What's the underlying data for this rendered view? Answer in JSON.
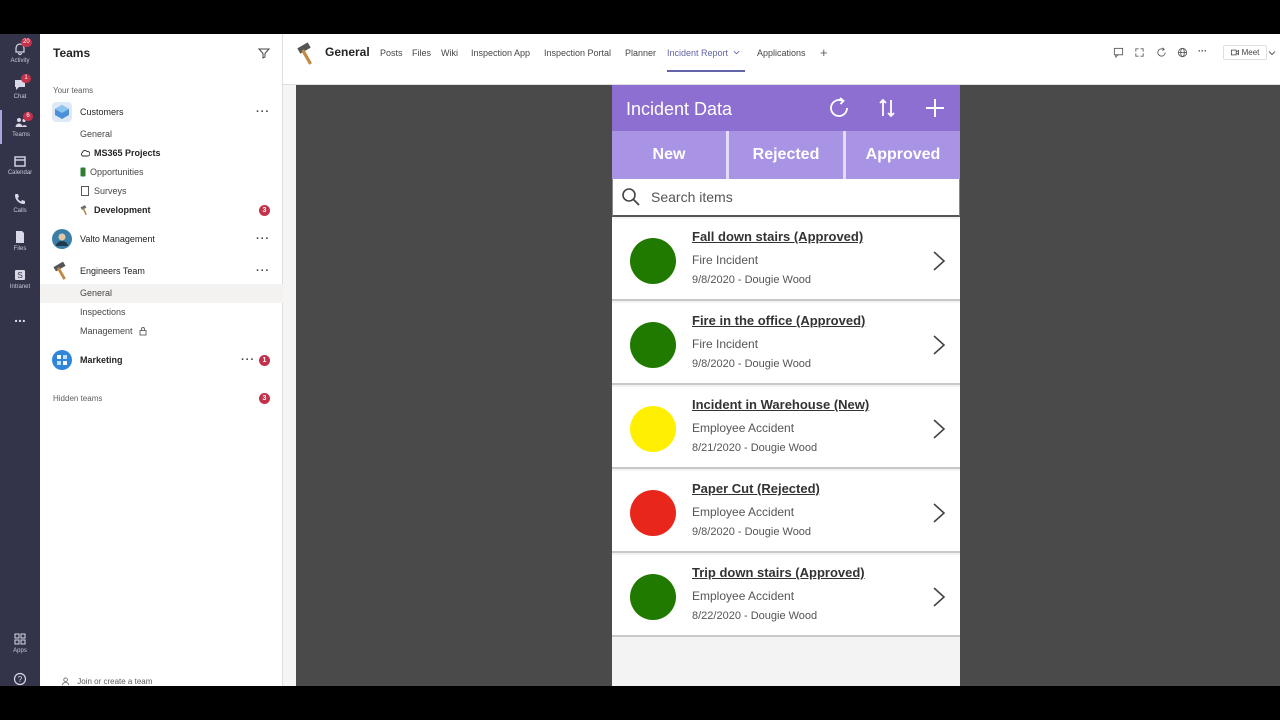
{
  "rail": {
    "items": [
      {
        "label": "Activity",
        "badge": "20"
      },
      {
        "label": "Chat",
        "badge": "1"
      },
      {
        "label": "Teams",
        "badge": "6"
      },
      {
        "label": "Calendar",
        "badge": ""
      },
      {
        "label": "Calls",
        "badge": ""
      },
      {
        "label": "Files",
        "badge": ""
      },
      {
        "label": "Intranet",
        "badge": ""
      },
      {
        "label": "...",
        "badge": ""
      },
      {
        "label": "Apps",
        "badge": ""
      }
    ]
  },
  "teams_pane": {
    "title": "Teams",
    "your_teams": "Your teams",
    "customers": {
      "name": "Customers",
      "channels": [
        "General",
        "MS365 Projects",
        "Opportunities",
        "Surveys",
        "Development"
      ],
      "development_count": "3"
    },
    "valto": {
      "name": "Valto Management"
    },
    "engineers": {
      "name": "Engineers Team",
      "channels": [
        "General",
        "Inspections",
        "Management"
      ]
    },
    "marketing": {
      "name": "Marketing",
      "count": "1"
    },
    "hidden_teams": "Hidden teams",
    "hidden_count": "3",
    "join_create": "Join or create a team",
    "more": "···"
  },
  "header": {
    "channel": "General",
    "tabs": [
      "Posts",
      "Files",
      "Wiki",
      "Inspection App",
      "Inspection Portal",
      "Planner",
      "Incident Report",
      "Applications",
      "+"
    ],
    "active_tab": "Incident Report",
    "meet": "Meet"
  },
  "app": {
    "title": "Incident Data",
    "filters": [
      "New",
      "Rejected",
      "Approved"
    ],
    "search_placeholder": "Search items",
    "colors": {
      "approved": "#217a00",
      "new": "#ffef00",
      "rejected": "#e8261c",
      "header": "#8c6fd0",
      "tabs": "#a993e4"
    },
    "incidents": [
      {
        "title": "Fall down stairs (Approved)",
        "type": "Fire Incident",
        "meta": "9/8/2020 - Dougie Wood",
        "status": "approved"
      },
      {
        "title": "Fire in the office (Approved)",
        "type": "Fire Incident",
        "meta": "9/8/2020 - Dougie Wood",
        "status": "approved"
      },
      {
        "title": "Incident in Warehouse (New)",
        "type": "Employee Accident",
        "meta": "8/21/2020 - Dougie Wood",
        "status": "new"
      },
      {
        "title": "Paper Cut (Rejected)",
        "type": "Employee Accident",
        "meta": "9/8/2020 - Dougie Wood",
        "status": "rejected"
      },
      {
        "title": "Trip down stairs (Approved)",
        "type": "Employee Accident",
        "meta": "8/22/2020 - Dougie Wood",
        "status": "approved"
      }
    ]
  }
}
